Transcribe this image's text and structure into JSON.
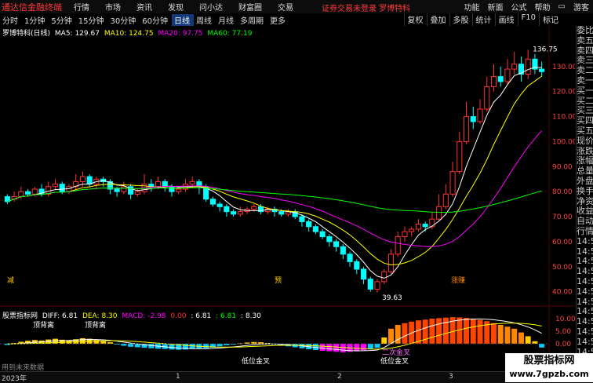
{
  "app": {
    "logo": "通达信金融终端",
    "menu": [
      "行情",
      "市场",
      "资讯",
      "发现",
      "问小达",
      "财富圈",
      "交易"
    ],
    "notice": "证券交易未登录  罗博特科",
    "right_menu": [
      "功能",
      "新面",
      "公式",
      "帮助"
    ],
    "right_label": "游客"
  },
  "toolbar": {
    "periods": [
      "分时",
      "1分钟",
      "5分钟",
      "15分钟",
      "30分钟",
      "60分钟",
      "日线",
      "周线",
      "月线",
      "多周期",
      "更多"
    ],
    "active_period": "日线",
    "right_tools": [
      "复权",
      "叠加",
      "多股",
      "统计",
      "画线",
      "F10",
      "标记"
    ]
  },
  "chart_header": {
    "name": "罗博特科(日线)",
    "ma5": "MA5: 129.67",
    "ma10": "MA10: 124.75",
    "ma20": "MA20: 97.75",
    "ma60": "MA60: 77.19",
    "colors": {
      "ma5": "#ffffff",
      "ma10": "#ffff00",
      "ma20": "#ff00ff",
      "ma60": "#00ff00"
    }
  },
  "price_axis": [
    "130.00",
    "120.00",
    "110.00",
    "100.00",
    "90.00",
    "80.00",
    "70.00",
    "60.00",
    "50.00",
    "40.00"
  ],
  "annotations": {
    "high": "136.75",
    "low": "39.63",
    "mark_left": "减",
    "mark_mid": "预",
    "mark_right": "涨赚"
  },
  "side_panel": [
    "委比",
    "卖五",
    "卖四",
    "卖三",
    "卖二",
    "卖一",
    "买一",
    "买二",
    "买三",
    "买四",
    "买五",
    "现价",
    "涨跌",
    "涨幅",
    "总量",
    "外盘",
    "换手",
    "净资",
    "收益",
    "自动",
    "行情",
    "14:5",
    "14:5",
    "14:5",
    "14:5",
    "14:5",
    "14:5",
    "14:5",
    "14:5",
    "14:5",
    "14:5",
    "14:5",
    "14:5",
    "14:5"
  ],
  "macd_header": {
    "name": "股票指标网",
    "diff": "DIFF: 6.81",
    "dea": "DEA: 8.30",
    "macd": "MACD: -2.98",
    "v1": "0.00",
    "v2": ": 6.81",
    "v3": ": 6.81",
    "v4": ": 8.30"
  },
  "macd_axis": [
    "10.00",
    "5.00",
    "0.00"
  ],
  "macd_labels": {
    "top1": "顶背离",
    "top2": "顶背离",
    "gold1": "低位金叉",
    "gold2": "低位金叉",
    "second": "二次金叉",
    "nodata": "用到未来数据"
  },
  "bottom_bar": {
    "year": "2023年",
    "m1": "1",
    "m2": "2",
    "m3": "3"
  },
  "watermark": {
    "line1": "股票指标网",
    "line2": "www.7gpzb.com"
  },
  "chart_data": {
    "type": "candlestick",
    "ylim": [
      38,
      140
    ],
    "ma_labels": [
      "MA5",
      "MA10",
      "MA20",
      "MA60"
    ],
    "candles": [
      [
        78,
        76,
        79,
        75
      ],
      [
        77,
        78,
        80,
        76
      ],
      [
        78,
        80,
        82,
        77
      ],
      [
        80,
        79,
        81,
        78
      ],
      [
        79,
        81,
        82,
        78
      ],
      [
        81,
        79,
        83,
        78
      ],
      [
        79,
        82,
        84,
        78
      ],
      [
        82,
        83,
        85,
        81
      ],
      [
        83,
        80,
        84,
        79
      ],
      [
        80,
        82,
        83,
        79
      ],
      [
        82,
        84,
        87,
        81
      ],
      [
        84,
        86,
        88,
        82
      ],
      [
        86,
        83,
        87,
        82
      ],
      [
        83,
        85,
        86,
        81
      ],
      [
        85,
        84,
        86,
        82
      ],
      [
        84,
        81,
        85,
        79
      ],
      [
        81,
        80,
        82,
        78
      ],
      [
        80,
        82,
        84,
        79
      ],
      [
        82,
        79,
        83,
        77
      ],
      [
        79,
        80,
        81,
        78
      ],
      [
        80,
        83,
        87,
        79
      ],
      [
        83,
        82,
        85,
        80
      ],
      [
        82,
        84,
        86,
        81
      ],
      [
        84,
        82,
        85,
        80
      ],
      [
        82,
        80,
        83,
        78
      ],
      [
        80,
        81,
        82,
        79
      ],
      [
        81,
        83,
        85,
        80
      ],
      [
        83,
        84,
        86,
        82
      ],
      [
        84,
        82,
        85,
        79
      ],
      [
        82,
        77,
        83,
        76
      ],
      [
        77,
        75,
        78,
        74
      ],
      [
        75,
        74,
        76,
        72
      ],
      [
        74,
        72,
        75,
        70
      ],
      [
        72,
        71,
        73,
        70
      ],
      [
        71,
        72,
        74,
        70
      ],
      [
        72,
        73,
        74,
        71
      ],
      [
        73,
        74,
        75,
        72
      ],
      [
        74,
        72,
        75,
        71
      ],
      [
        72,
        73,
        74,
        71
      ],
      [
        73,
        72,
        74,
        70
      ],
      [
        72,
        71,
        73,
        70
      ],
      [
        71,
        72,
        73,
        70
      ],
      [
        72,
        70,
        73,
        69
      ],
      [
        70,
        68,
        71,
        66
      ],
      [
        68,
        66,
        69,
        64
      ],
      [
        66,
        64,
        67,
        63
      ],
      [
        64,
        62,
        65,
        61
      ],
      [
        62,
        60,
        63,
        58
      ],
      [
        60,
        58,
        61,
        56
      ],
      [
        58,
        55,
        59,
        53
      ],
      [
        55,
        52,
        56,
        50
      ],
      [
        52,
        49,
        53,
        47
      ],
      [
        49,
        45,
        50,
        43
      ],
      [
        45,
        41,
        46,
        40
      ],
      [
        41,
        44,
        45,
        39.63
      ],
      [
        44,
        48,
        49,
        43
      ],
      [
        48,
        55,
        57,
        47
      ],
      [
        55,
        62,
        64,
        54
      ],
      [
        62,
        64,
        66,
        60
      ],
      [
        64,
        65,
        66,
        62
      ],
      [
        65,
        67,
        69,
        64
      ],
      [
        67,
        66,
        68,
        64
      ],
      [
        66,
        69,
        72,
        65
      ],
      [
        69,
        74,
        79,
        68
      ],
      [
        74,
        79,
        83,
        73
      ],
      [
        79,
        88,
        92,
        78
      ],
      [
        88,
        100,
        104,
        87
      ],
      [
        100,
        110,
        116,
        99
      ],
      [
        110,
        108,
        114,
        105
      ],
      [
        108,
        113,
        117,
        107
      ],
      [
        113,
        122,
        126,
        112
      ],
      [
        122,
        126,
        131,
        120
      ],
      [
        126,
        124,
        130,
        122
      ],
      [
        124,
        129,
        133,
        123
      ],
      [
        129,
        131,
        136,
        127
      ],
      [
        131,
        127,
        134,
        124
      ],
      [
        127,
        133,
        136.75,
        125
      ],
      [
        133,
        129,
        135,
        127
      ],
      [
        129,
        128,
        132,
        126
      ]
    ],
    "macd_hist": [
      -0.5,
      0.3,
      0.8,
      1.2,
      1.5,
      1.3,
      1.7,
      2.0,
      1.6,
      1.4,
      1.8,
      2.2,
      2.0,
      1.5,
      1.0,
      0.6,
      -0.3,
      -0.8,
      -1.2,
      -1.4,
      -1.6,
      -1.8,
      -2.0,
      -2.1,
      -2.3,
      -2.4,
      -2.3,
      -2.1,
      -2.0,
      -1.8,
      -1.5,
      -1.0,
      -0.6,
      -0.3,
      0.2,
      0.5,
      0.7,
      0.6,
      0.3,
      -0.2,
      -0.6,
      -1.0,
      -1.4,
      -1.8,
      -2.2,
      -2.5,
      -2.8,
      -3.0,
      -3.2,
      -3.4,
      -3.2,
      -3.0,
      -2.6,
      -2.2,
      -1.6,
      2.5,
      6.0,
      7.5,
      8.2,
      8.8,
      9.3,
      9.6,
      10.0,
      10.2,
      10.4,
      10.6,
      10.5,
      10.3,
      10.0,
      9.5,
      9.0,
      8.2,
      7.5,
      6.8,
      6.0,
      4.5,
      3.0,
      1.0,
      -1.5
    ]
  }
}
